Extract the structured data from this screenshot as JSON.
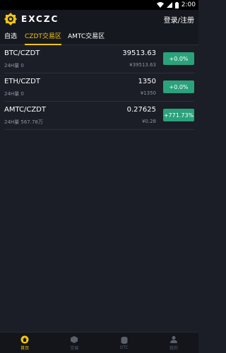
{
  "status_bar": {
    "time": "2:00"
  },
  "header": {
    "app_name": "EXCZC",
    "login_label": "登录/注册"
  },
  "tabs": [
    {
      "label": "自选"
    },
    {
      "label": "CZDT交易区"
    },
    {
      "label": "AMTC交易区"
    }
  ],
  "markets": [
    {
      "pair": "BTC/CZDT",
      "volume": "24H量 0",
      "price": "39513.63",
      "cny": "¥39513.63",
      "change": "+0.0%"
    },
    {
      "pair": "ETH/CZDT",
      "volume": "24H量 0",
      "price": "1350",
      "cny": "¥1350",
      "change": "+0.0%"
    },
    {
      "pair": "AMTC/CZDT",
      "volume": "24H量 567.78万",
      "price": "0.27625",
      "cny": "¥0.28",
      "change": "+771.73%"
    }
  ],
  "bottom_nav": [
    {
      "label": "首页",
      "icon": "home-icon"
    },
    {
      "label": "交易",
      "icon": "trade-icon"
    },
    {
      "label": "OTC",
      "icon": "otc-icon"
    },
    {
      "label": "我的",
      "icon": "profile-icon"
    }
  ],
  "colors": {
    "accent": "#f1c40f",
    "positive": "#2aa27b",
    "background": "#1b1e26"
  }
}
